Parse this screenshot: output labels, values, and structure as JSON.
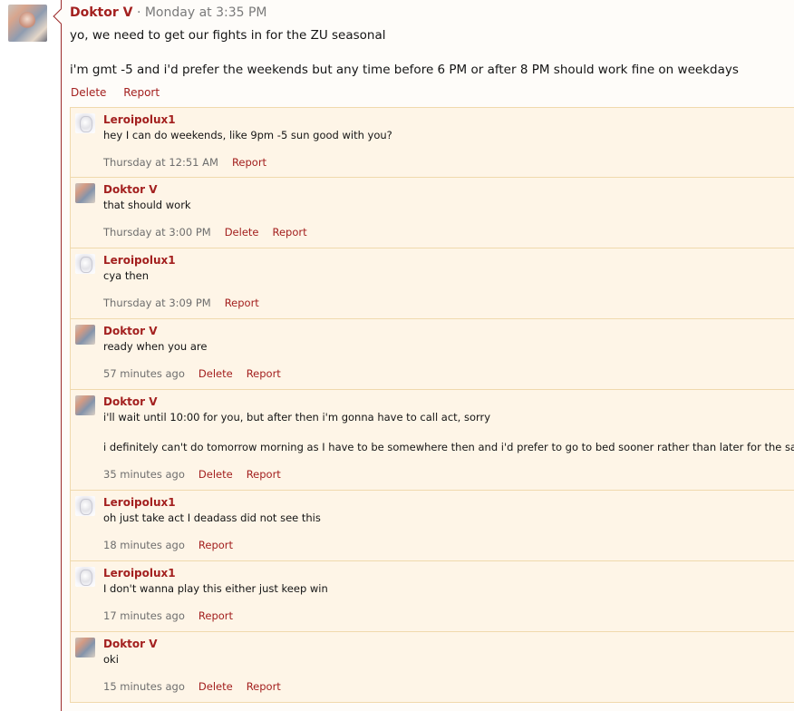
{
  "post": {
    "author": "Doktor V",
    "separator": "·",
    "time": "Monday at 3:35 PM",
    "body_line1": "yo, we need to get our fights in for the ZU seasonal",
    "body_line2": "i'm gmt -5 and i'd prefer the weekends but any time before 6 PM or after 8 PM should work fine on weekdays",
    "actions": {
      "delete": "Delete",
      "report": "Report"
    },
    "avatar_icon": "user-avatar-icon"
  },
  "comments": [
    {
      "author": "Leroipolux1",
      "avatar": "leroipolux1",
      "lines": [
        "hey I can do weekends, like 9pm -5 sun good with you?"
      ],
      "time": "Thursday at 12:51 AM",
      "delete": "",
      "report": "Report"
    },
    {
      "author": "Doktor V",
      "avatar": "doktor",
      "lines": [
        "that should work"
      ],
      "time": "Thursday at 3:00 PM",
      "delete": "Delete",
      "report": "Report"
    },
    {
      "author": "Leroipolux1",
      "avatar": "leroipolux1",
      "lines": [
        "cya then"
      ],
      "time": "Thursday at 3:09 PM",
      "delete": "",
      "report": "Report"
    },
    {
      "author": "Doktor V",
      "avatar": "doktor",
      "lines": [
        "ready when you are"
      ],
      "time": "57 minutes ago",
      "delete": "Delete",
      "report": "Report"
    },
    {
      "author": "Doktor V",
      "avatar": "doktor",
      "lines": [
        "i'll wait until 10:00 for you, but after then i'm gonna have to call act, sorry",
        "i definitely can't do tomorrow morning as I have to be somewhere then and i'd prefer to go to bed sooner rather than later for the same reason"
      ],
      "time": "35 minutes ago",
      "delete": "Delete",
      "report": "Report"
    },
    {
      "author": "Leroipolux1",
      "avatar": "leroipolux1",
      "lines": [
        "oh just take act I deadass did not see this"
      ],
      "time": "18 minutes ago",
      "delete": "",
      "report": "Report"
    },
    {
      "author": "Leroipolux1",
      "avatar": "leroipolux1",
      "lines": [
        "I don't wanna play this either just keep win"
      ],
      "time": "17 minutes ago",
      "delete": "",
      "report": "Report"
    },
    {
      "author": "Doktor V",
      "avatar": "doktor",
      "lines": [
        "oki"
      ],
      "time": "15 minutes ago",
      "delete": "Delete",
      "report": "Report"
    }
  ],
  "colors": {
    "accent": "#a3201f",
    "comment_bg": "#fef5e7",
    "comment_border": "#f0d9ad",
    "muted_text": "#6e6e6e"
  }
}
